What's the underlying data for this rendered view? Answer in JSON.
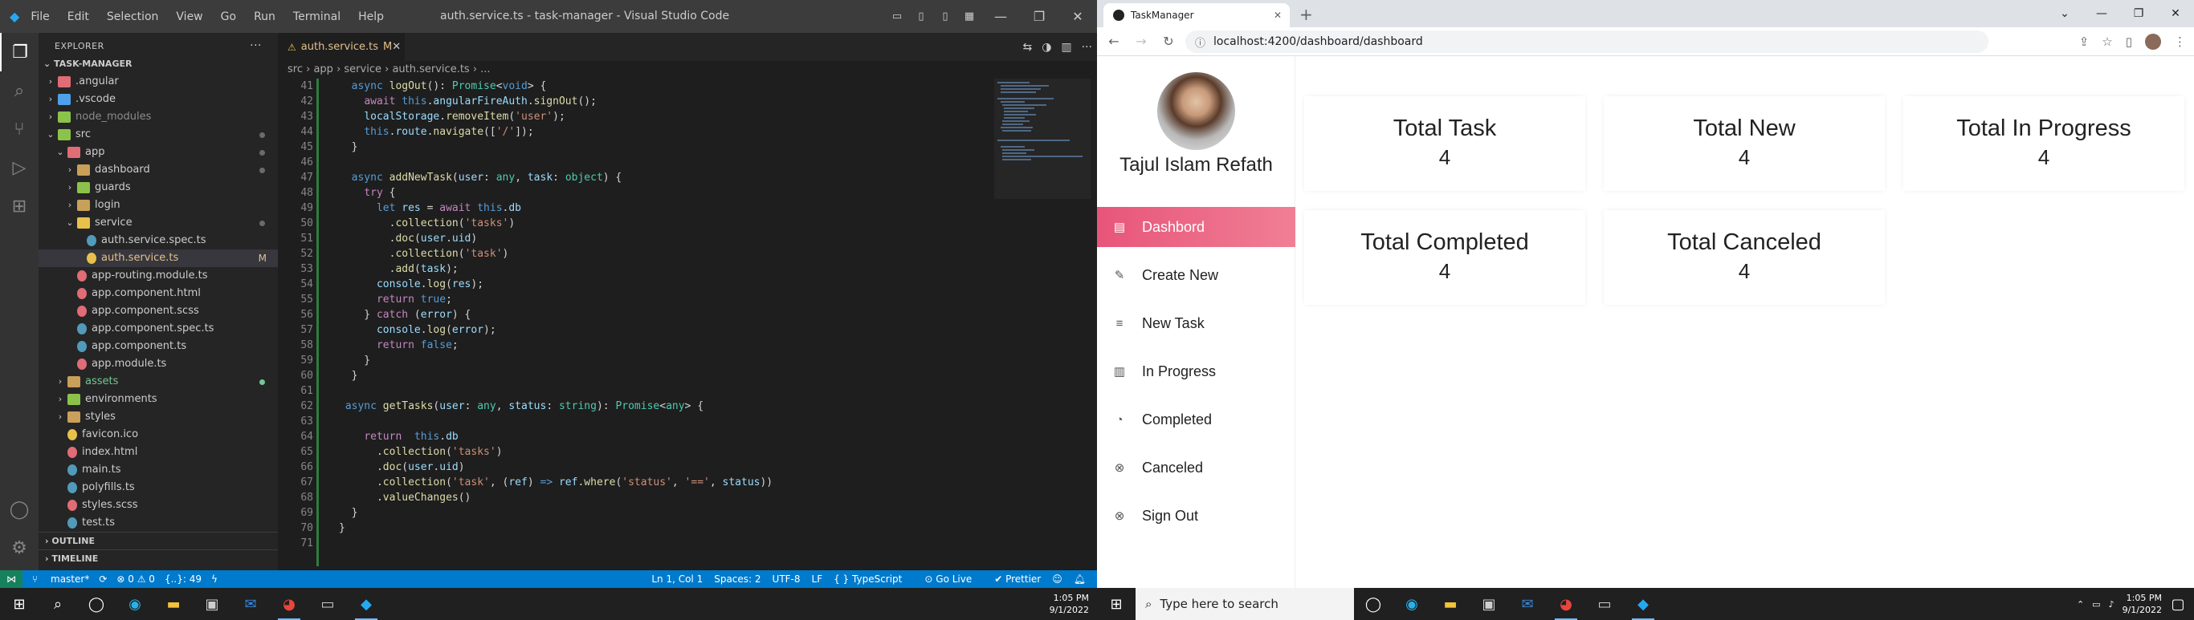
{
  "vscode": {
    "title": "auth.service.ts - task-manager - Visual Studio Code",
    "menu": [
      "File",
      "Edit",
      "Selection",
      "View",
      "Go",
      "Run",
      "Terminal",
      "Help"
    ],
    "explorer_label": "EXPLORER",
    "project": "TASK-MANAGER",
    "tree": [
      {
        "label": ".angular",
        "depth": 1,
        "type": "folder",
        "chev": "›",
        "color": "#e06c75"
      },
      {
        "label": ".vscode",
        "depth": 1,
        "type": "folder",
        "chev": "›",
        "color": "#4ea1e8"
      },
      {
        "label": "node_modules",
        "depth": 1,
        "type": "folder",
        "chev": "›",
        "color": "#8bc34a",
        "muted": true
      },
      {
        "label": "src",
        "depth": 1,
        "type": "folder",
        "chev": "⌄",
        "color": "#8bc34a",
        "dot": "gray"
      },
      {
        "label": "app",
        "depth": 2,
        "type": "folder",
        "chev": "⌄",
        "color": "#e06c75",
        "dot": "gray"
      },
      {
        "label": "dashboard",
        "depth": 3,
        "type": "folder",
        "chev": "›",
        "color": "#c8a05a",
        "dot": "gray"
      },
      {
        "label": "guards",
        "depth": 3,
        "type": "folder",
        "chev": "›",
        "color": "#8bc34a"
      },
      {
        "label": "login",
        "depth": 3,
        "type": "folder",
        "chev": "›",
        "color": "#c8a05a"
      },
      {
        "label": "service",
        "depth": 3,
        "type": "folder",
        "chev": "⌄",
        "color": "#e8c14a",
        "dot": "gray"
      },
      {
        "label": "auth.service.spec.ts",
        "depth": 4,
        "type": "file",
        "color": "#519aba"
      },
      {
        "label": "auth.service.ts",
        "depth": 4,
        "type": "file",
        "color": "#e8c14a",
        "mod": "M",
        "selected": true
      },
      {
        "label": "app-routing.module.ts",
        "depth": 3,
        "type": "file",
        "color": "#e06c75"
      },
      {
        "label": "app.component.html",
        "depth": 3,
        "type": "file",
        "color": "#e06c75"
      },
      {
        "label": "app.component.scss",
        "depth": 3,
        "type": "file",
        "color": "#e06c75"
      },
      {
        "label": "app.component.spec.ts",
        "depth": 3,
        "type": "file",
        "color": "#519aba"
      },
      {
        "label": "app.component.ts",
        "depth": 3,
        "type": "file",
        "color": "#519aba"
      },
      {
        "label": "app.module.ts",
        "depth": 3,
        "type": "file",
        "color": "#e06c75"
      },
      {
        "label": "assets",
        "depth": 2,
        "type": "folder",
        "chev": "›",
        "color": "#c8a05a",
        "dot": "green",
        "green": true
      },
      {
        "label": "environments",
        "depth": 2,
        "type": "folder",
        "chev": "›",
        "color": "#8bc34a"
      },
      {
        "label": "styles",
        "depth": 2,
        "type": "folder",
        "chev": "›",
        "color": "#c8a05a"
      },
      {
        "label": "favicon.ico",
        "depth": 2,
        "type": "file",
        "color": "#e8c14a"
      },
      {
        "label": "index.html",
        "depth": 2,
        "type": "file",
        "color": "#e06c75"
      },
      {
        "label": "main.ts",
        "depth": 2,
        "type": "file",
        "color": "#519aba"
      },
      {
        "label": "polyfills.ts",
        "depth": 2,
        "type": "file",
        "color": "#519aba"
      },
      {
        "label": "styles.scss",
        "depth": 2,
        "type": "file",
        "color": "#e06c75"
      },
      {
        "label": "test.ts",
        "depth": 2,
        "type": "file",
        "color": "#519aba"
      }
    ],
    "outline": "OUTLINE",
    "timeline": "TIMELINE",
    "tab": {
      "label": "auth.service.ts",
      "modified": "M"
    },
    "breadcrumb": [
      "src",
      "app",
      "service",
      "auth.service.ts",
      "..."
    ],
    "code": [
      {
        "n": "41",
        "html": "  <span class='k'>async</span> <span class='f'>logOut</span>(): <span class='t'>Promise</span>&lt;<span class='k'>void</span>&gt; {"
      },
      {
        "n": "42",
        "html": "    <span class='kc'>await</span> <span class='k'>this</span>.<span class='v'>angularFireAuth</span>.<span class='f'>signOut</span>();"
      },
      {
        "n": "43",
        "html": "    <span class='v'>localStorage</span>.<span class='f'>removeItem</span>(<span class='s'>'user'</span>);"
      },
      {
        "n": "44",
        "html": "    <span class='k'>this</span>.<span class='v'>route</span>.<span class='f'>navigate</span>([<span class='s'>'/'</span>]);"
      },
      {
        "n": "45",
        "html": "  }"
      },
      {
        "n": "46",
        "html": ""
      },
      {
        "n": "47",
        "html": "  <span class='k'>async</span> <span class='f'>addNewTask</span>(<span class='v'>user</span>: <span class='t'>any</span>, <span class='v'>task</span>: <span class='t'>object</span>) {"
      },
      {
        "n": "48",
        "html": "    <span class='kc'>try</span> {"
      },
      {
        "n": "49",
        "html": "      <span class='k'>let</span> <span class='v'>res</span> = <span class='kc'>await</span> <span class='k'>this</span>.<span class='v'>db</span>"
      },
      {
        "n": "50",
        "html": "        .<span class='f'>collection</span>(<span class='s'>'tasks'</span>)"
      },
      {
        "n": "51",
        "html": "        .<span class='f'>doc</span>(<span class='v'>user</span>.<span class='v'>uid</span>)"
      },
      {
        "n": "52",
        "html": "        .<span class='f'>collection</span>(<span class='s'>'task'</span>)"
      },
      {
        "n": "53",
        "html": "        .<span class='f'>add</span>(<span class='v'>task</span>);"
      },
      {
        "n": "54",
        "html": "      <span class='v'>console</span>.<span class='f'>log</span>(<span class='v'>res</span>);"
      },
      {
        "n": "55",
        "html": "      <span class='kc'>return</span> <span class='k'>true</span>;"
      },
      {
        "n": "56",
        "html": "    } <span class='kc'>catch</span> (<span class='v'>error</span>) {"
      },
      {
        "n": "57",
        "html": "      <span class='v'>console</span>.<span class='f'>log</span>(<span class='v'>error</span>);"
      },
      {
        "n": "58",
        "html": "      <span class='kc'>return</span> <span class='k'>false</span>;"
      },
      {
        "n": "59",
        "html": "    }"
      },
      {
        "n": "60",
        "html": "  }"
      },
      {
        "n": "61",
        "html": ""
      },
      {
        "n": "62",
        "html": " <span class='k'>async</span> <span class='f'>getTasks</span>(<span class='v'>user</span>: <span class='t'>any</span>, <span class='v'>status</span>: <span class='t'>string</span>): <span class='t'>Promise</span>&lt;<span class='t'>any</span>&gt; {"
      },
      {
        "n": "63",
        "html": ""
      },
      {
        "n": "64",
        "html": "    <span class='kc'>return</span>  <span class='k'>this</span>.<span class='v'>db</span>"
      },
      {
        "n": "65",
        "html": "      .<span class='f'>collection</span>(<span class='s'>'tasks'</span>)"
      },
      {
        "n": "66",
        "html": "      .<span class='f'>doc</span>(<span class='v'>user</span>.<span class='v'>uid</span>)"
      },
      {
        "n": "67",
        "html": "      .<span class='f'>collection</span>(<span class='s'>'task'</span>, (<span class='v'>ref</span>) <span class='k'>=&gt;</span> <span class='v'>ref</span>.<span class='f'>where</span>(<span class='s'>'status'</span>, <span class='s'>'=='</span>, <span class='v'>status</span>))"
      },
      {
        "n": "68",
        "html": "      .<span class='f'>valueChanges</span>()"
      },
      {
        "n": "69",
        "html": "  }"
      },
      {
        "n": "70",
        "html": "}"
      },
      {
        "n": "71",
        "html": ""
      }
    ],
    "status": {
      "branch": "master*",
      "errors": "⊗ 0 ⚠ 0",
      "braces": "{..}: 49",
      "position": "Ln 1, Col 1",
      "spaces": "Spaces: 2",
      "encoding": "UTF-8",
      "eol": "LF",
      "language": "TypeScript",
      "golive": "Go Live",
      "prettier": "✔ Prettier"
    },
    "clock": {
      "time": "1:05 PM",
      "date": "9/1/2022"
    }
  },
  "browser": {
    "tab_title": "TaskManager",
    "url": "localhost:4200/dashboard/dashboard",
    "user_name": "Tajul Islam Refath",
    "menu": [
      {
        "label": "Dashbord",
        "icon": "▤",
        "active": true
      },
      {
        "label": "Create New",
        "icon": "✎"
      },
      {
        "label": "New Task",
        "icon": "≡"
      },
      {
        "label": "In Progress",
        "icon": "▥"
      },
      {
        "label": "Completed",
        "icon": "◔"
      },
      {
        "label": "Canceled",
        "icon": "⊗"
      },
      {
        "label": "Sign Out",
        "icon": "⊗"
      }
    ],
    "cards": [
      {
        "title": "Total Task",
        "value": "4"
      },
      {
        "title": "Total New",
        "value": "4"
      },
      {
        "title": "Total In Progress",
        "value": "4"
      },
      {
        "title": "Total Completed",
        "value": "4"
      },
      {
        "title": "Total Canceled",
        "value": "4"
      }
    ],
    "taskbar_search": "Type here to search",
    "clock": {
      "time": "1:05 PM",
      "date": "9/1/2022"
    }
  },
  "colors": {
    "accent": "#007acc",
    "menu_active": "#e8557a"
  }
}
